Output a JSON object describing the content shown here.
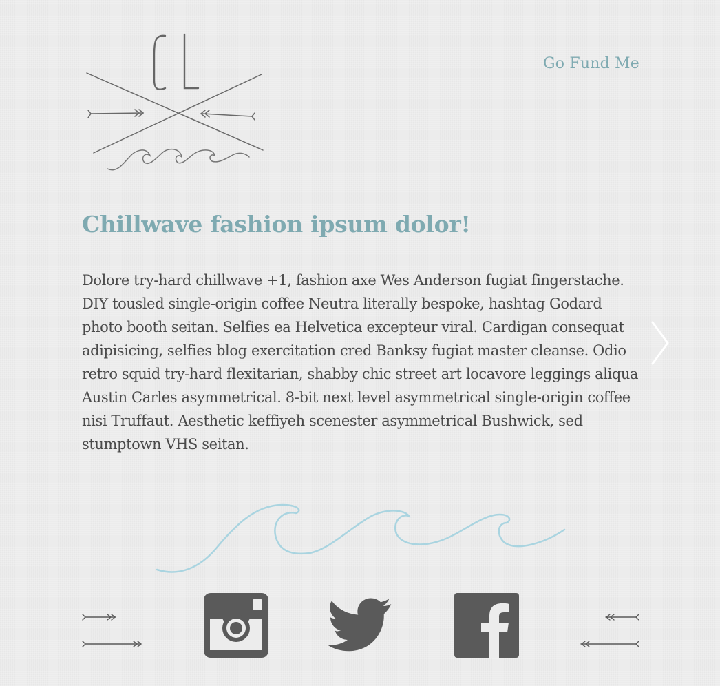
{
  "header": {
    "logo_alt": "CL",
    "nav_link": "Go Fund Me"
  },
  "main": {
    "headline": "Chillwave fashion ipsum dolor!",
    "body": "Dolore try-hard chillwave +1, fashion axe Wes Anderson fugiat fingerstache. DIY tousled single-origin coffee Neutra literally bespoke, hashtag Godard photo booth seitan. Selfies ea Helvetica excepteur viral. Cardigan consequat adipisicing, selfies blog exercitation cred Banksy fugiat master cleanse. Odio retro squid try-hard flexitarian, shabby chic street art locavore leggings aliqua Austin Carles asymmetrical. 8-bit next level asymmetrical single-origin coffee nisi Truffaut. Aesthetic keffiyeh scenester asymmetrical Bushwick, sed stumptown VHS seitan."
  },
  "carousel": {
    "next_icon": "chevron-right-icon"
  },
  "footer": {
    "social": [
      {
        "name": "instagram",
        "icon": "instagram-icon"
      },
      {
        "name": "twitter",
        "icon": "twitter-icon"
      },
      {
        "name": "facebook",
        "icon": "facebook-icon"
      }
    ]
  },
  "colors": {
    "accent": "#7faab1",
    "text": "#4a4a4a",
    "icon": "#5a5a5a",
    "wave": "#a9d4e0",
    "background": "#ececec"
  }
}
